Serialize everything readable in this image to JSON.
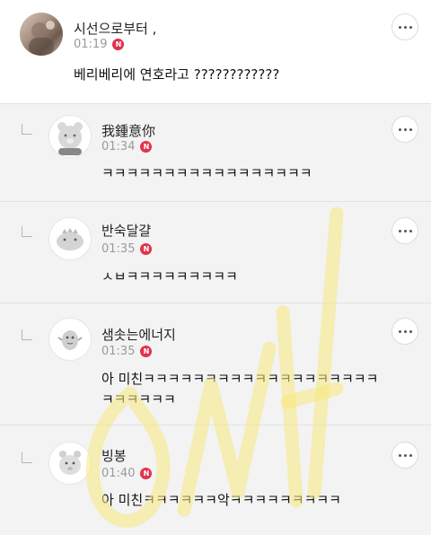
{
  "comments": [
    {
      "username": "시선으로부터 ,",
      "time": "01:19",
      "badge": "N",
      "content": "베리베리에 연호라고 ????????????",
      "reply": false
    },
    {
      "username": "我鍾意你",
      "time": "01:34",
      "badge": "N",
      "content": "ㅋㅋㅋㅋㅋㅋㅋㅋㅋㅋㅋㅋㅋㅋㅋㅋㅋ",
      "reply": true
    },
    {
      "username": "반숙달걀",
      "time": "01:35",
      "badge": "N",
      "content": "ㅅㅂㅋㅋㅋㅋㅋㅋㅋㅋㅋ",
      "reply": true
    },
    {
      "username": "샘솟는에너지",
      "time": "01:35",
      "badge": "N",
      "content_line1": "아 미친ㅋㅋㅋㅋㅋㅋㅋㅋㅋㅋㅋㅋㅋㅋㅋㅋㅋㅋㅋ",
      "content_line2": "ㅋㅋㅋㅋㅋㅋ",
      "reply": true
    },
    {
      "username": "빙봉",
      "time": "01:40",
      "badge": "N",
      "content": "아 미친ㅋㅋㅋㅋㅋㅋ악ㅋㅋㅋㅋㅋㅋㅋㅋㅋ",
      "reply": true
    }
  ],
  "watermark": {
    "color": "#f5e77a",
    "text_visible": false
  }
}
